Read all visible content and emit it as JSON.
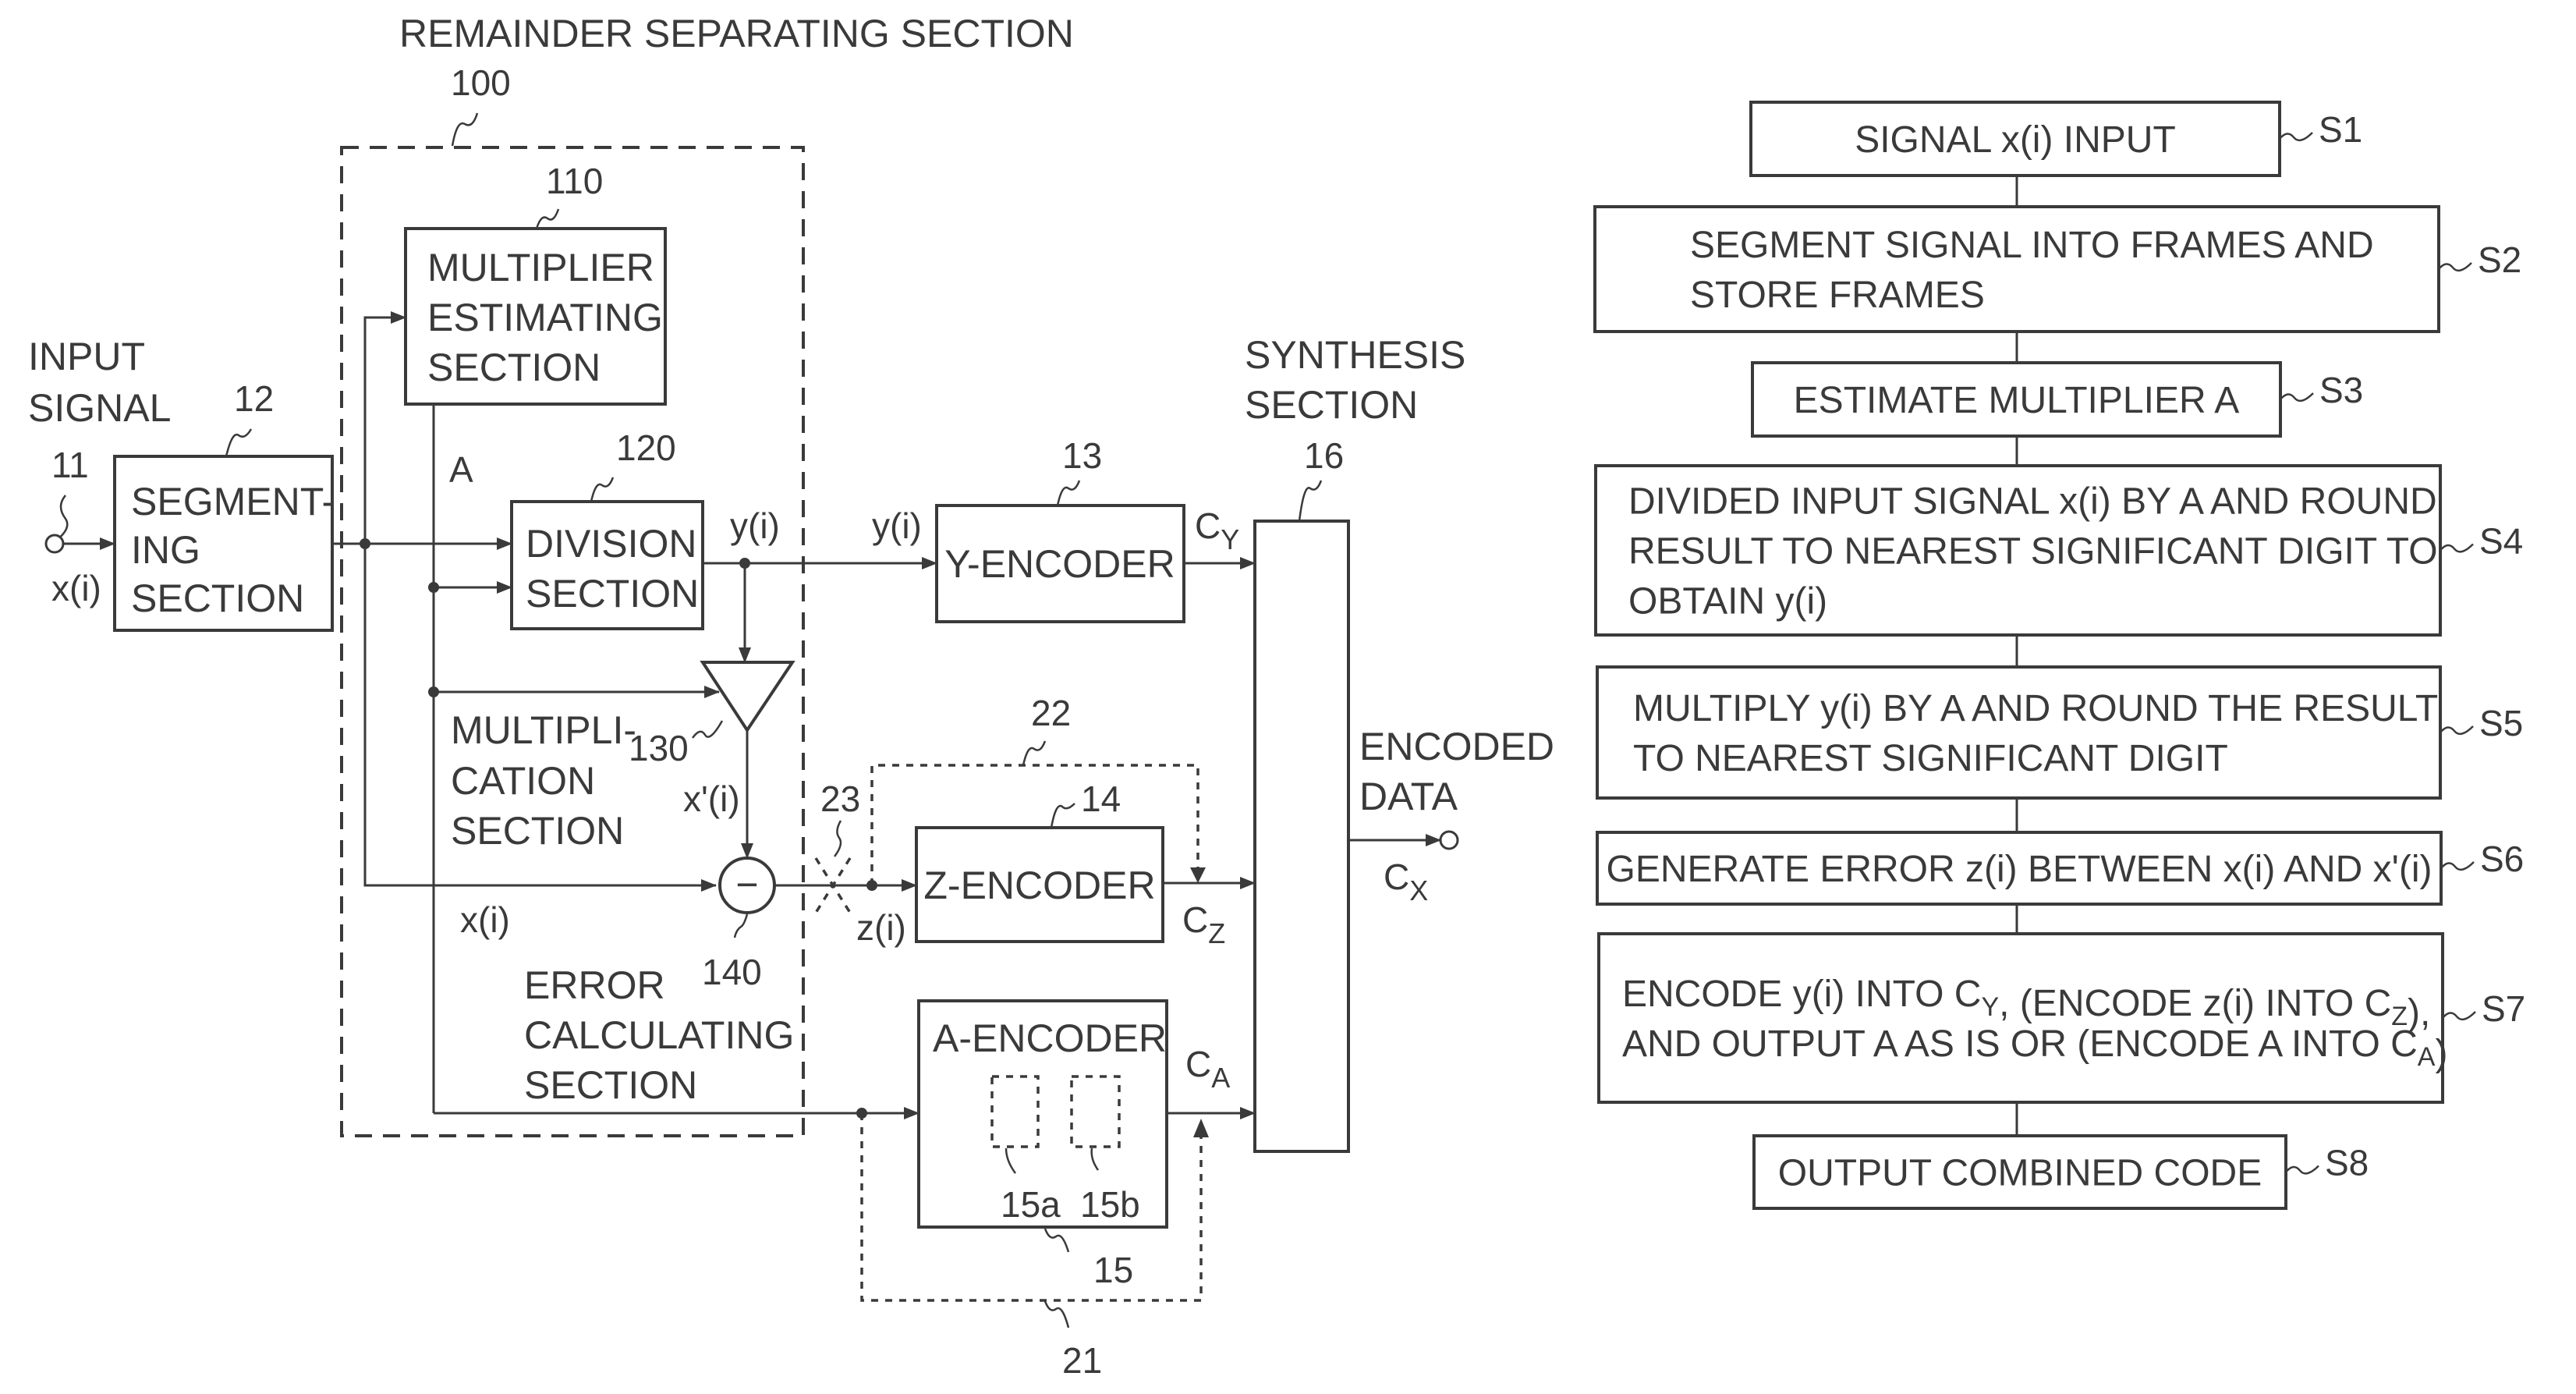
{
  "block_diagram": {
    "remainder_section": {
      "title": "REMAINDER SEPARATING SECTION",
      "ref": "100"
    },
    "input": {
      "label_lines": [
        "INPUT",
        "SIGNAL"
      ],
      "ref": "11",
      "signal": "x(i)"
    },
    "segmenting": {
      "label_lines": [
        "SEGMENT-",
        "ING",
        "SECTION"
      ],
      "ref": "12"
    },
    "multiplier_estimating": {
      "label_lines": [
        "MULTIPLIER",
        "ESTIMATING",
        "SECTION"
      ],
      "ref": "110",
      "output": "A"
    },
    "division": {
      "label_lines": [
        "DIVISION",
        "SECTION"
      ],
      "ref": "120",
      "output": "y(i)"
    },
    "multiplication": {
      "label_lines": [
        "MULTIPLI-",
        "CATION",
        "SECTION"
      ],
      "ref": "130",
      "output": "x'(i)"
    },
    "error_calculating": {
      "label_lines": [
        "ERROR",
        "CALCULATING",
        "SECTION"
      ],
      "ref": "140",
      "input": "x(i)"
    },
    "y_encoder": {
      "label": "Y-ENCODER",
      "ref": "13",
      "input": "y(i)",
      "output_main": "C",
      "output_sub": "Y"
    },
    "z_encoder": {
      "label": "Z-ENCODER",
      "ref": "14",
      "input": "z(i)",
      "output_main": "C",
      "output_sub": "Z"
    },
    "a_encoder": {
      "label": "A-ENCODER",
      "ref": "15",
      "sub_refs": [
        "15a",
        "15b"
      ],
      "output_main": "C",
      "output_sub": "A"
    },
    "synthesis": {
      "label_lines": [
        "SYNTHESIS",
        "SECTION"
      ],
      "ref": "16"
    },
    "output": {
      "label_lines": [
        "ENCODED",
        "DATA"
      ],
      "output_main": "C",
      "output_sub": "X"
    },
    "bypass_refs": {
      "a_bypass": "21",
      "z_bypass": "22",
      "switch": "23"
    },
    "subtract_symbol": "−"
  },
  "flowchart": {
    "steps": [
      {
        "id": "S1",
        "lines": [
          "SIGNAL x(i) INPUT"
        ]
      },
      {
        "id": "S2",
        "lines": [
          "SEGMENT SIGNAL INTO FRAMES AND",
          "STORE FRAMES"
        ]
      },
      {
        "id": "S3",
        "lines": [
          "ESTIMATE MULTIPLIER A"
        ]
      },
      {
        "id": "S4",
        "lines": [
          "DIVIDED INPUT SIGNAL x(i) BY A AND ROUND",
          "RESULT TO NEAREST SIGNIFICANT DIGIT TO",
          "OBTAIN y(i)"
        ]
      },
      {
        "id": "S5",
        "lines": [
          "MULTIPLY y(i) BY A AND ROUND THE RESULT",
          "TO NEAREST SIGNIFICANT DIGIT"
        ]
      },
      {
        "id": "S6",
        "lines": [
          "GENERATE ERROR z(i) BETWEEN x(i) AND x'(i)"
        ]
      },
      {
        "id": "S7",
        "lines": [
          [
            [
              "ENCODE y(i) INTO C",
              ""
            ],
            [
              "Y",
              "sub"
            ],
            [
              ", (ENCODE z(i) INTO C",
              ""
            ],
            [
              "Z",
              "sub"
            ],
            [
              "),",
              ""
            ]
          ],
          [
            [
              "AND OUTPUT A AS IS OR (ENCODE A INTO C",
              ""
            ],
            [
              "A",
              "sub"
            ],
            [
              ")",
              ""
            ]
          ]
        ]
      },
      {
        "id": "S8",
        "lines": [
          "OUTPUT COMBINED CODE"
        ]
      }
    ]
  },
  "colors": {
    "ink": "#3a3a3a",
    "background": "#ffffff"
  }
}
